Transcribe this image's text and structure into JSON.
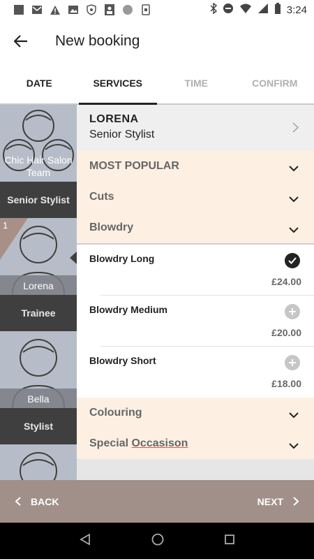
{
  "status_bar": {
    "time": "3:24"
  },
  "app_bar": {
    "title": "New booking"
  },
  "tabs": [
    {
      "label": "DATE"
    },
    {
      "label": "SERVICES"
    },
    {
      "label": "TIME"
    },
    {
      "label": "CONFIRM"
    }
  ],
  "staff": [
    {
      "name": "Chic Hair Salon Team",
      "role": "Senior Stylist"
    },
    {
      "name": "Lorena",
      "role": "Trainee",
      "badge": "1"
    },
    {
      "name": "Bella",
      "role": "Stylist"
    }
  ],
  "stylist_header": {
    "name": "LORENA",
    "title": "Senior Stylist"
  },
  "categories": {
    "most_popular": "MOST POPULAR",
    "cuts": "Cuts",
    "blowdry": "Blowdry",
    "colouring": "Colouring",
    "special_prefix": "Special ",
    "special_word": "Occasison"
  },
  "services": [
    {
      "name": "Blowdry Long",
      "price": "£24.00",
      "selected": true
    },
    {
      "name": "Blowdry Medium",
      "price": "£20.00",
      "selected": false
    },
    {
      "name": "Blowdry Short",
      "price": "£18.00",
      "selected": false
    }
  ],
  "bottom_bar": {
    "back_label": "BACK",
    "next_label": "NEXT"
  },
  "colors": {
    "accent": "#a09089",
    "category_bg": "#fdf0e3",
    "role_bg": "#3f3f3f"
  }
}
